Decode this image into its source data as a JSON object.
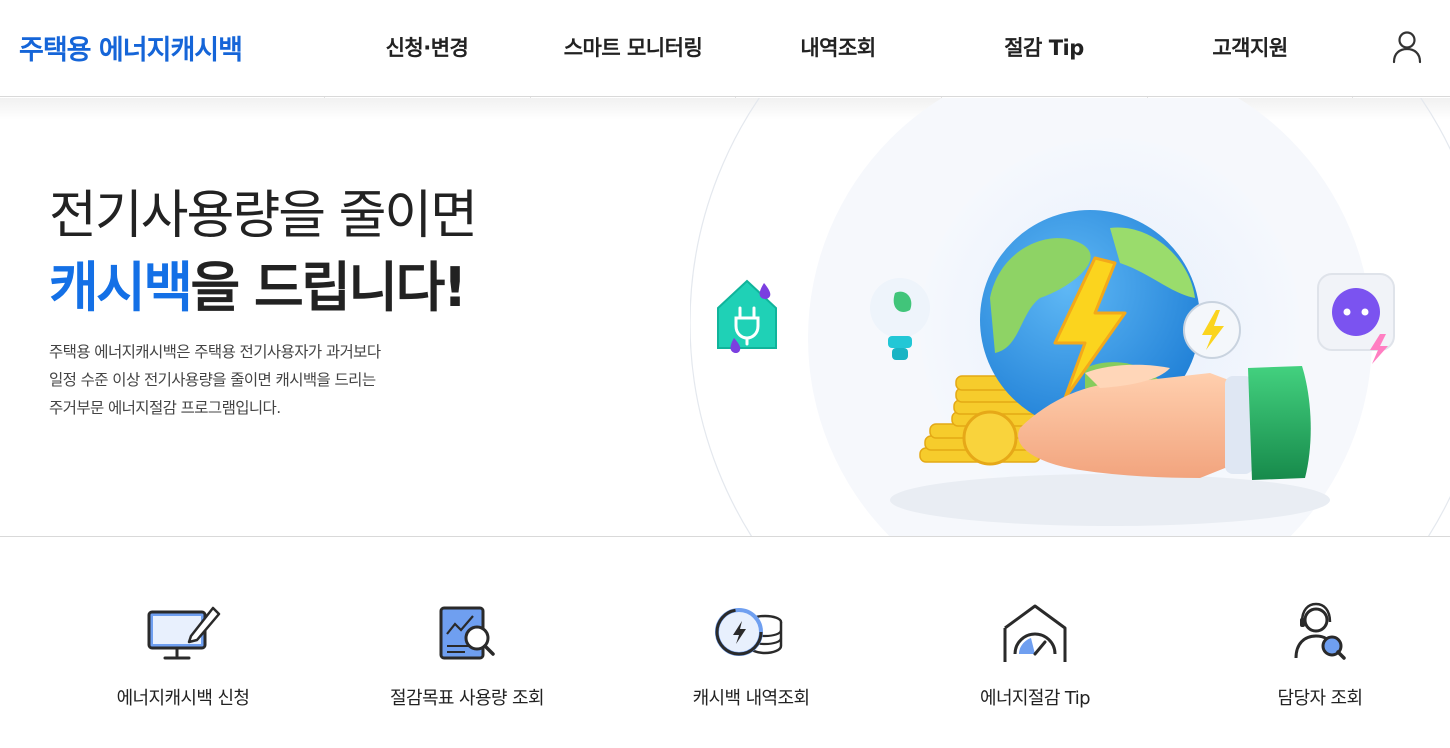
{
  "header": {
    "logo": "주택용 에너지캐시백",
    "nav": [
      "신청·변경",
      "스마트 모니터링",
      "내역조회",
      "절감 Tip",
      "고객지원"
    ],
    "user_icon": "user-icon"
  },
  "hero": {
    "title_line1": "전기사용량을 줄이면",
    "title_accent": "캐시백",
    "title_line2_rest": "을 드립니다!",
    "description": [
      "주택용 에너지캐시백은 주택용 전기사용자가 과거보다",
      "일정 수준 이상 전기사용량을 줄이면 캐시백을 드리는",
      "주거부문 에너지절감 프로그램입니다."
    ]
  },
  "quick_menu": [
    {
      "label": "에너지캐시백 신청",
      "icon": "monitor-pen-icon"
    },
    {
      "label": "절감목표 사용량 조회",
      "icon": "report-search-icon"
    },
    {
      "label": "캐시백 내역조회",
      "icon": "cashback-coins-icon"
    },
    {
      "label": "에너지절감 Tip",
      "icon": "house-gauge-icon"
    },
    {
      "label": "담당자 조회",
      "icon": "support-agent-icon"
    }
  ],
  "colors": {
    "brand": "#1565d8",
    "accent": "#1470e6",
    "icon_fill": "#6f9ff0",
    "icon_stroke": "#2a2a2a"
  }
}
